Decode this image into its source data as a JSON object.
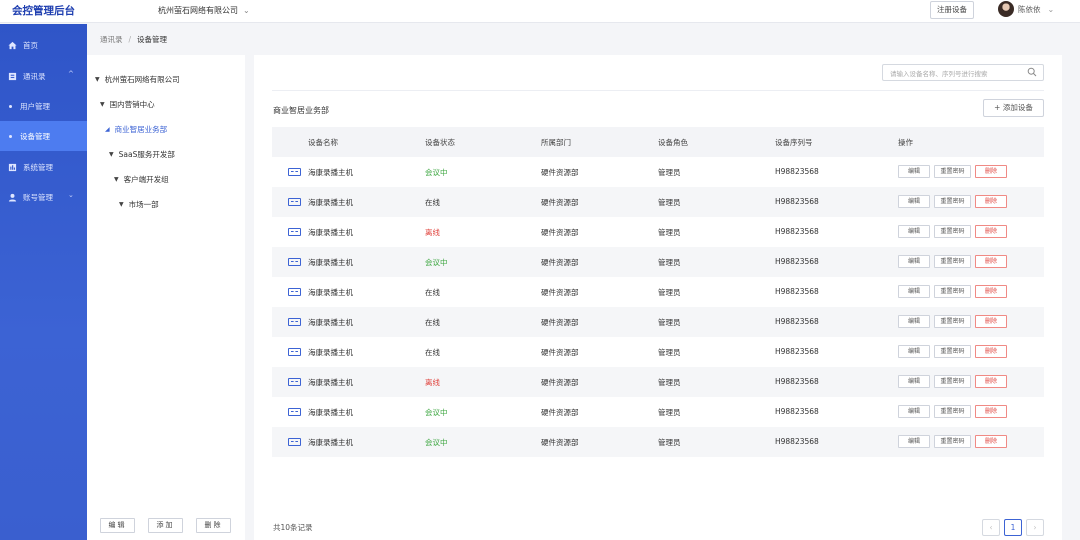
{
  "app": {
    "title": "会控管理后台"
  },
  "header": {
    "company": "杭州萤石网络有限公司",
    "register_label": "注册设备",
    "user_name": "陈依依"
  },
  "sidebar": {
    "items": [
      {
        "label": "首页",
        "icon": "home-icon"
      },
      {
        "label": "通讯录",
        "icon": "contacts-icon"
      },
      {
        "label": "用户管理"
      },
      {
        "label": "设备管理"
      },
      {
        "label": "系统管理",
        "icon": "system-icon"
      },
      {
        "label": "账号管理",
        "icon": "account-icon"
      }
    ]
  },
  "breadcrumb": {
    "root": "通讯录",
    "sep": "/",
    "current": "设备管理"
  },
  "tree": {
    "nodes": [
      {
        "label": "杭州萤石网络有限公司"
      },
      {
        "label": "国内营销中心"
      },
      {
        "label": "商业智居业务部"
      },
      {
        "label": "SaaS服务开发部"
      },
      {
        "label": "客户端开发组"
      },
      {
        "label": "市场一部"
      }
    ],
    "buttons": {
      "edit": "编辑",
      "add": "添加",
      "delete": "删除"
    }
  },
  "search": {
    "placeholder": "请输入设备名称、序列号进行搜索"
  },
  "section": {
    "title": "商业智居业务部",
    "add_label": "+ 添加设备"
  },
  "table": {
    "headers": [
      "设备名称",
      "设备状态",
      "所属部门",
      "设备角色",
      "设备序列号",
      "操作"
    ],
    "actions": {
      "edit": "编辑",
      "reset": "重置密码",
      "delete": "删除"
    },
    "rows": [
      {
        "name": "海康录播主机",
        "status": "会议中",
        "dept": "硬件资源部",
        "role": "管理员",
        "serial": "H98823568"
      },
      {
        "name": "海康录播主机",
        "status": "在线",
        "dept": "硬件资源部",
        "role": "管理员",
        "serial": "H98823568"
      },
      {
        "name": "海康录播主机",
        "status": "离线",
        "dept": "硬件资源部",
        "role": "管理员",
        "serial": "H98823568"
      },
      {
        "name": "海康录播主机",
        "status": "会议中",
        "dept": "硬件资源部",
        "role": "管理员",
        "serial": "H98823568"
      },
      {
        "name": "海康录播主机",
        "status": "在线",
        "dept": "硬件资源部",
        "role": "管理员",
        "serial": "H98823568"
      },
      {
        "name": "海康录播主机",
        "status": "在线",
        "dept": "硬件资源部",
        "role": "管理员",
        "serial": "H98823568"
      },
      {
        "name": "海康录播主机",
        "status": "在线",
        "dept": "硬件资源部",
        "role": "管理员",
        "serial": "H98823568"
      },
      {
        "name": "海康录播主机",
        "status": "离线",
        "dept": "硬件资源部",
        "role": "管理员",
        "serial": "H98823568"
      },
      {
        "name": "海康录播主机",
        "status": "会议中",
        "dept": "硬件资源部",
        "role": "管理员",
        "serial": "H98823568"
      },
      {
        "name": "海康录播主机",
        "status": "会议中",
        "dept": "硬件资源部",
        "role": "管理员",
        "serial": "H98823568"
      }
    ]
  },
  "footer": {
    "total": "共10条记录",
    "page": "1",
    "prev": "‹",
    "next": "›"
  },
  "colors": {
    "primary": "#3c63d4",
    "online_meeting": "#3aa53e",
    "offline": "#e0443e"
  }
}
